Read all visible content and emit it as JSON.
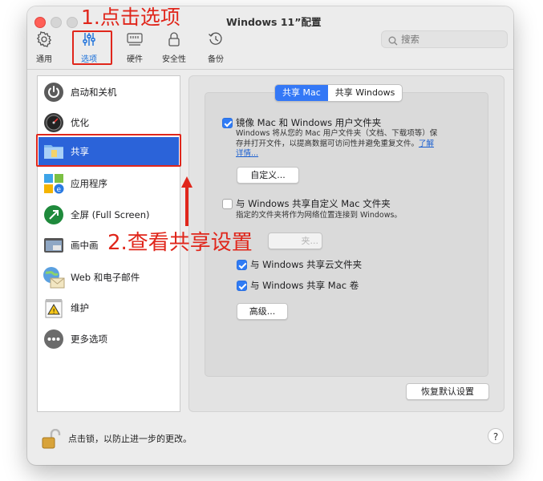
{
  "window": {
    "title": "Windows 11”配置"
  },
  "toolbar": {
    "items": [
      {
        "label": "通用",
        "icon": "gear-icon"
      },
      {
        "label": "选项",
        "icon": "sliders-icon"
      },
      {
        "label": "硬件",
        "icon": "hardware-icon"
      },
      {
        "label": "安全性",
        "icon": "lock-icon"
      },
      {
        "label": "备份",
        "icon": "backup-clock-icon"
      }
    ],
    "search_placeholder": "搜索"
  },
  "annotations": {
    "step1": "1.点击选项",
    "step2": "2.查看共享设置",
    "color": "#e0261b"
  },
  "sidebar": {
    "items": [
      {
        "label": "启动和关机",
        "icon": "power-icon"
      },
      {
        "label": "优化",
        "icon": "speedometer-icon"
      },
      {
        "label": "共享",
        "icon": "shared-folder-icon",
        "selected": true
      },
      {
        "label": "应用程序",
        "icon": "applications-icon"
      },
      {
        "label": "全屏 (Full Screen)",
        "icon": "fullscreen-icon"
      },
      {
        "label": "画中画",
        "icon": "picture-in-picture-icon"
      },
      {
        "label": "Web 和电子邮件",
        "icon": "web-mail-icon"
      },
      {
        "label": "维护",
        "icon": "maintenance-icon"
      },
      {
        "label": "更多选项",
        "icon": "more-options-icon"
      }
    ]
  },
  "tabs": {
    "share_mac": "共享 Mac",
    "share_windows": "共享 Windows",
    "active": "share_mac"
  },
  "options": {
    "mirror": {
      "label": "镜像 Mac 和 Windows 用户文件夹",
      "checked": true,
      "desc_line1": "Windows 将从您的 Mac 用户文件夹（文档、下载项等）保",
      "desc_line2": "存并打开文件，以提高数据可访问性并避免重复文件。",
      "link_part1": "了解",
      "link_part2": "详情...",
      "button": "自定义..."
    },
    "custom_share": {
      "label": "与 Windows 共享自定义 Mac 文件夹",
      "checked": false,
      "desc": "指定的文件夹将作为网络位置连接到 Windows。",
      "button": "夹..."
    },
    "cloud": {
      "label": "与 Windows 共享云文件夹",
      "checked": true
    },
    "volumes": {
      "label": "与 Windows 共享 Mac 卷",
      "checked": true
    },
    "advanced_button": "高级..."
  },
  "restore_defaults": "恢复默认设置",
  "footer": {
    "lock_text": "点击锁，以防止进一步的更改。",
    "help": "?"
  }
}
